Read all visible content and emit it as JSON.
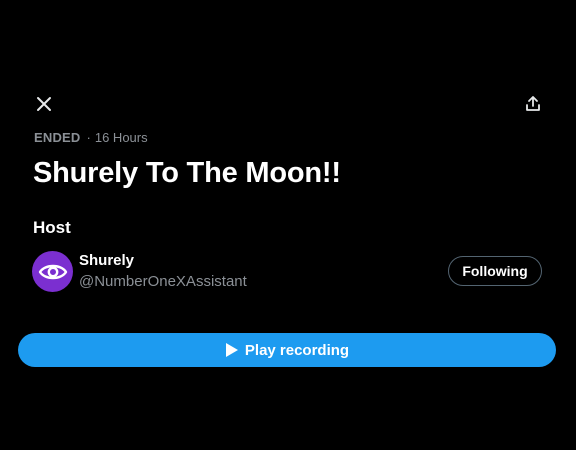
{
  "header": {
    "close_icon": "close-icon",
    "share_icon": "share-upload-icon"
  },
  "space": {
    "status": "ENDED",
    "separator": "·",
    "duration": "16 Hours",
    "title": "Shurely To The Moon!!"
  },
  "host_section": {
    "heading": "Host",
    "host": {
      "name": "Shurely",
      "handle": "@NumberOneXAssistant",
      "avatar_color": "#7b2fd0",
      "avatar_icon": "eye-icon",
      "follow_label": "Following"
    }
  },
  "player": {
    "play_label": "Play recording",
    "play_icon": "play-icon",
    "accent_color": "#1d9bf0"
  },
  "colors": {
    "background": "#000000",
    "primary_text": "#ffffff",
    "secondary_text": "#8b9096",
    "accent": "#1d9bf0"
  }
}
